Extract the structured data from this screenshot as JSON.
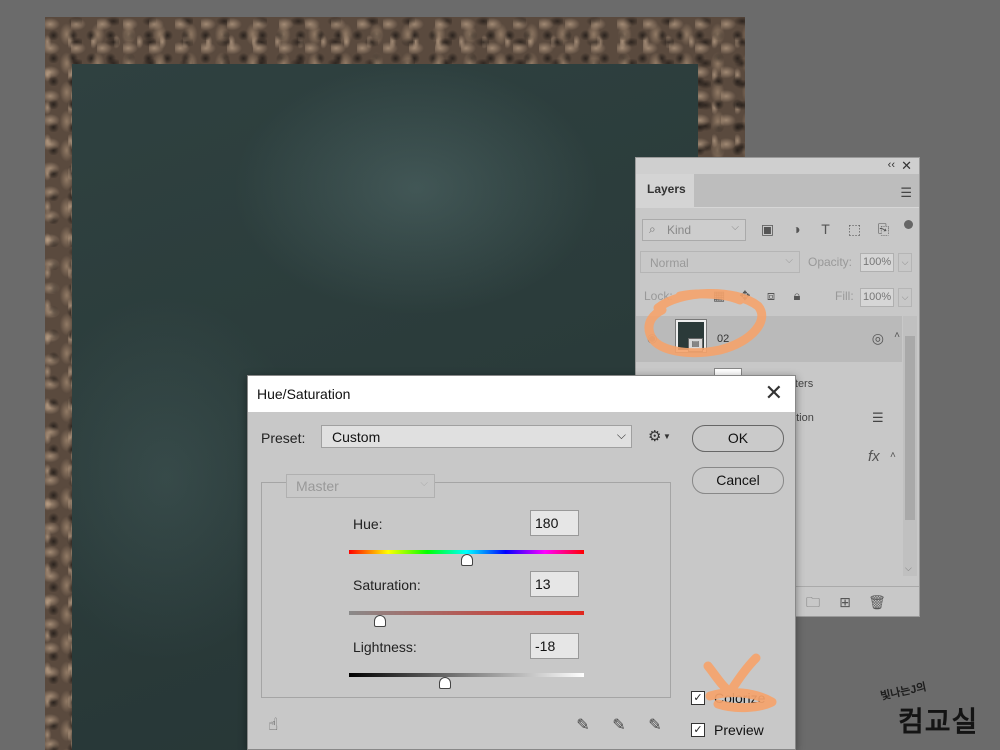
{
  "layers_panel": {
    "collapse_icon": "double-chevron",
    "close_icon": "x",
    "tab": "Layers",
    "kind_filter": {
      "placeholder": "Kind"
    },
    "blend_mode": "Normal",
    "opacity_label": "Opacity:",
    "opacity_value": "100%",
    "lock_label": "Lock:",
    "fill_label": "Fill:",
    "fill_value": "100%",
    "layer": {
      "name": "02"
    },
    "smart_filters_label": "ilters",
    "hue_sat_label": "ation",
    "fx_label": "fx"
  },
  "dialog": {
    "title": "Hue/Saturation",
    "close_glyph": "✕",
    "preset_label": "Preset:",
    "preset_value": "Custom",
    "ok_label": "OK",
    "cancel_label": "Cancel",
    "channel": "Master",
    "hue": {
      "label": "Hue:",
      "value": "180",
      "fraction": 0.5
    },
    "saturation": {
      "label": "Saturation:",
      "value": "13",
      "fraction": 0.13
    },
    "lightness": {
      "label": "Lightness:",
      "value": "-18",
      "fraction": 0.41
    },
    "colorize": {
      "label": "Colorize",
      "checked": true
    },
    "preview": {
      "label": "Preview",
      "checked": true
    }
  },
  "watermark": {
    "small": "빛나는J의",
    "big": "컴교실"
  },
  "colors": {
    "scribble": "#f5a36b",
    "panel_bg": "#c8c8c8",
    "dialog_title_bg": "#ffffff"
  }
}
